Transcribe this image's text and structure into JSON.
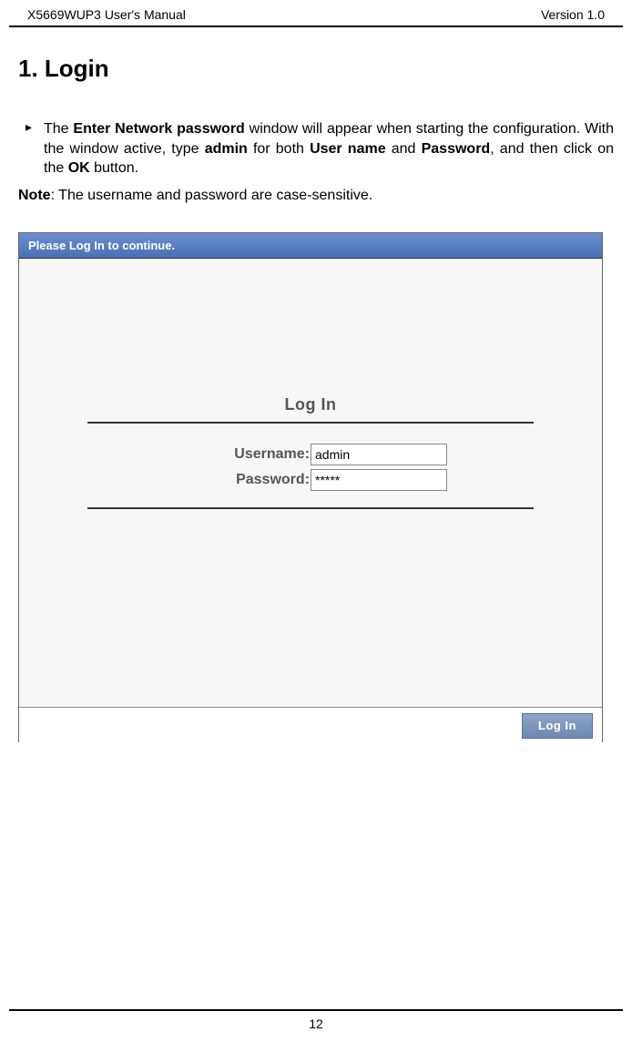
{
  "header": {
    "left": "X5669WUP3 User's Manual",
    "right": "Version 1.0"
  },
  "section": {
    "title": "1. Login"
  },
  "paragraph": {
    "part1": "The ",
    "bold1": "Enter Network password",
    "part2": " window will appear when starting the configuration. With the window active, type ",
    "bold2": "admin",
    "part3": " for both ",
    "bold3": "User name",
    "part4": " and ",
    "bold4": "Password",
    "part5": ", and then click on the ",
    "bold5": "OK",
    "part6": " button."
  },
  "note": {
    "label": "Note",
    "text": ": The username and password are case-sensitive."
  },
  "screenshot": {
    "header": "Please Log In to continue.",
    "login_title": "Log In",
    "username_label": "Username:",
    "username_value": "admin",
    "password_label": "Password:",
    "password_value": "*****",
    "login_button": "Log In"
  },
  "footer": {
    "page_number": "12"
  }
}
